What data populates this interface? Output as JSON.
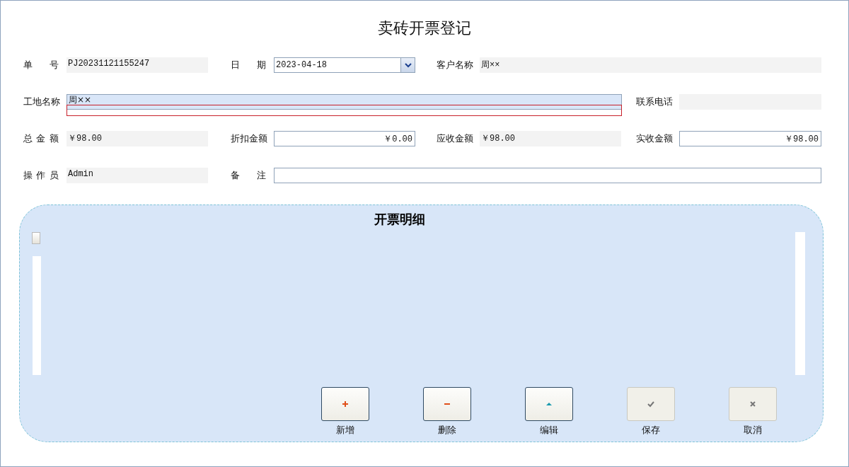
{
  "window": {
    "title": "卖砖开票登记"
  },
  "form_rows": [
    {
      "fields": [
        {
          "label": "单 号",
          "kind": "readonly",
          "value": "PJ20231121155247",
          "focused": false
        },
        {
          "label": "日 期",
          "kind": "date",
          "value": "2023-04-18",
          "focused": false
        },
        {
          "label": "客户名称",
          "kind": "readonly",
          "value": "周××",
          "focused": false
        }
      ]
    },
    {
      "fields": [
        {
          "label": "工地名称",
          "kind": "selected",
          "value": "周××",
          "focused": true
        },
        {
          "label": "联系电话",
          "kind": "readonly",
          "focused": false
        }
      ]
    },
    {
      "fields": [
        {
          "label": "总 金 额",
          "kind": "readonly",
          "value": "￥98.00",
          "focused": false
        },
        {
          "label": "折扣金额",
          "kind": "input",
          "value": "￥0.00",
          "focused": false
        },
        {
          "label": "应收金额",
          "kind": "readonly",
          "value": "￥98.00",
          "focused": false
        },
        {
          "label": "实收金额",
          "kind": "input",
          "value": "￥98.00",
          "focused": false
        }
      ]
    },
    {
      "fields": [
        {
          "label": "操 作 员",
          "kind": "readonly",
          "value": "Admin",
          "focused": false
        },
        {
          "label": "备 注",
          "kind": "input",
          "focused": false
        }
      ]
    }
  ],
  "details": {
    "title": "开票明细",
    "buttons": [
      {
        "label": "新增",
        "kind": "add",
        "disabled": false
      },
      {
        "label": "删除",
        "kind": "delete",
        "disabled": false
      },
      {
        "label": "编辑",
        "kind": "edit",
        "disabled": false
      },
      {
        "label": "保存",
        "kind": "save",
        "disabled": true
      },
      {
        "label": "取消",
        "kind": "cancel",
        "disabled": true
      }
    ]
  }
}
